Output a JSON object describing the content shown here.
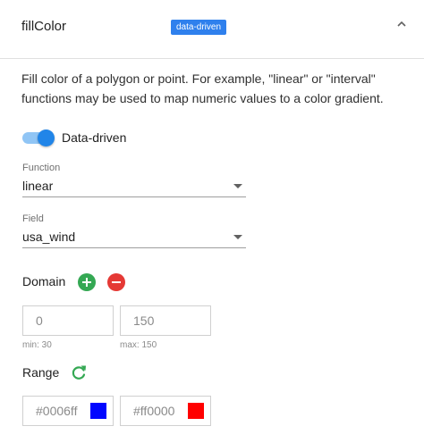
{
  "header": {
    "title": "fillColor",
    "badge": "data-driven",
    "collapse_icon": "chevron-up-icon"
  },
  "description": "Fill color of a polygon or point. For example, \"linear\" or \"interval\" functions may be used to map numeric values to a color gradient.",
  "data_driven_toggle": {
    "label": "Data-driven",
    "on": true,
    "track_color": "#90c5f5",
    "knob_color": "#2185e8"
  },
  "function_select": {
    "label": "Function",
    "value": "linear"
  },
  "field_select": {
    "label": "Field",
    "value": "usa_wind"
  },
  "domain": {
    "label": "Domain",
    "add_icon": "add-circle-icon",
    "remove_icon": "remove-circle-icon",
    "min_value": "0",
    "max_value": "150",
    "min_hint": "min: 30",
    "max_hint": "max: 150"
  },
  "range": {
    "label": "Range",
    "reset_icon": "refresh-icon",
    "start_color_text": "#0006ff",
    "start_color": "#0006ff",
    "end_color_text": "#ff0000",
    "end_color": "#ff0000"
  },
  "colors": {
    "badge": "#2f80ed",
    "add": "#34a853",
    "remove": "#e53935"
  }
}
